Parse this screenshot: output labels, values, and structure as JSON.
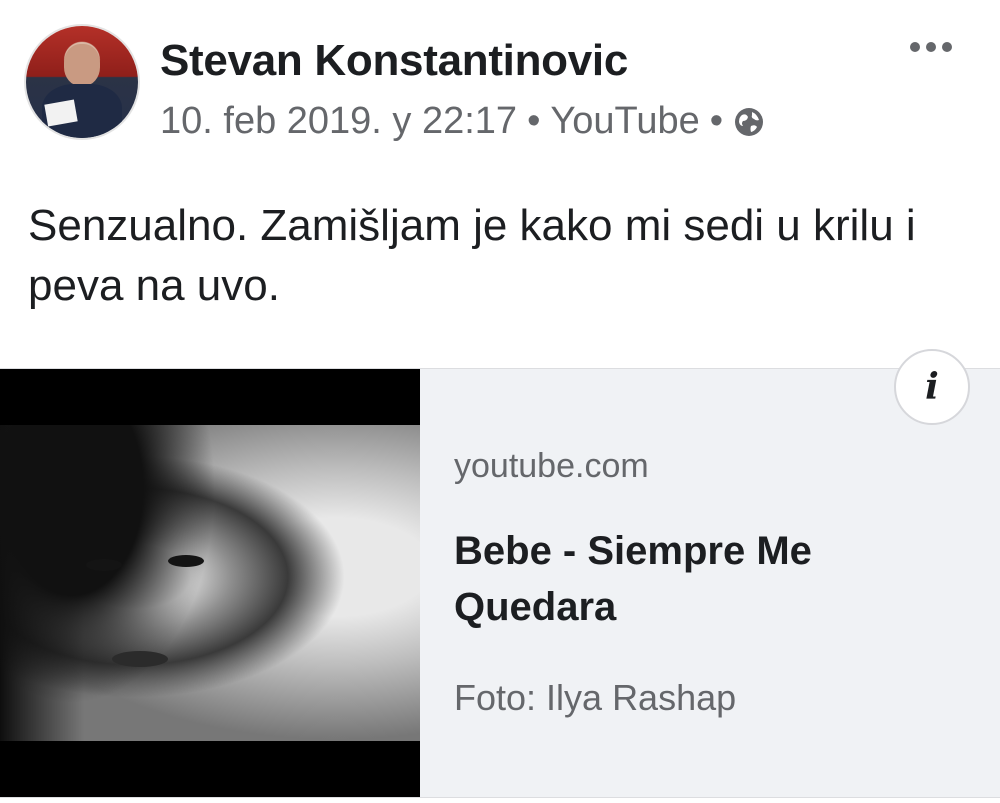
{
  "post": {
    "author": "Stevan Konstantinovic",
    "meta": {
      "timestamp": "10. feb 2019. у 22:17",
      "separator": "•",
      "source": "YouTube",
      "privacy_icon": "globe-icon"
    },
    "more_icon": "more-options-icon",
    "text": "Senzualno. Zamišljam je kako mi sedi u krilu i peva na uvo."
  },
  "link_card": {
    "domain": "youtube.com",
    "title": "Bebe - Siempre Me Quedara",
    "caption": "Foto: Ilya Rashap",
    "info_icon": "info-icon",
    "info_glyph": "i"
  },
  "colors": {
    "text_primary": "#1c1e21",
    "text_secondary": "#65676b",
    "card_background": "#f0f2f5"
  }
}
